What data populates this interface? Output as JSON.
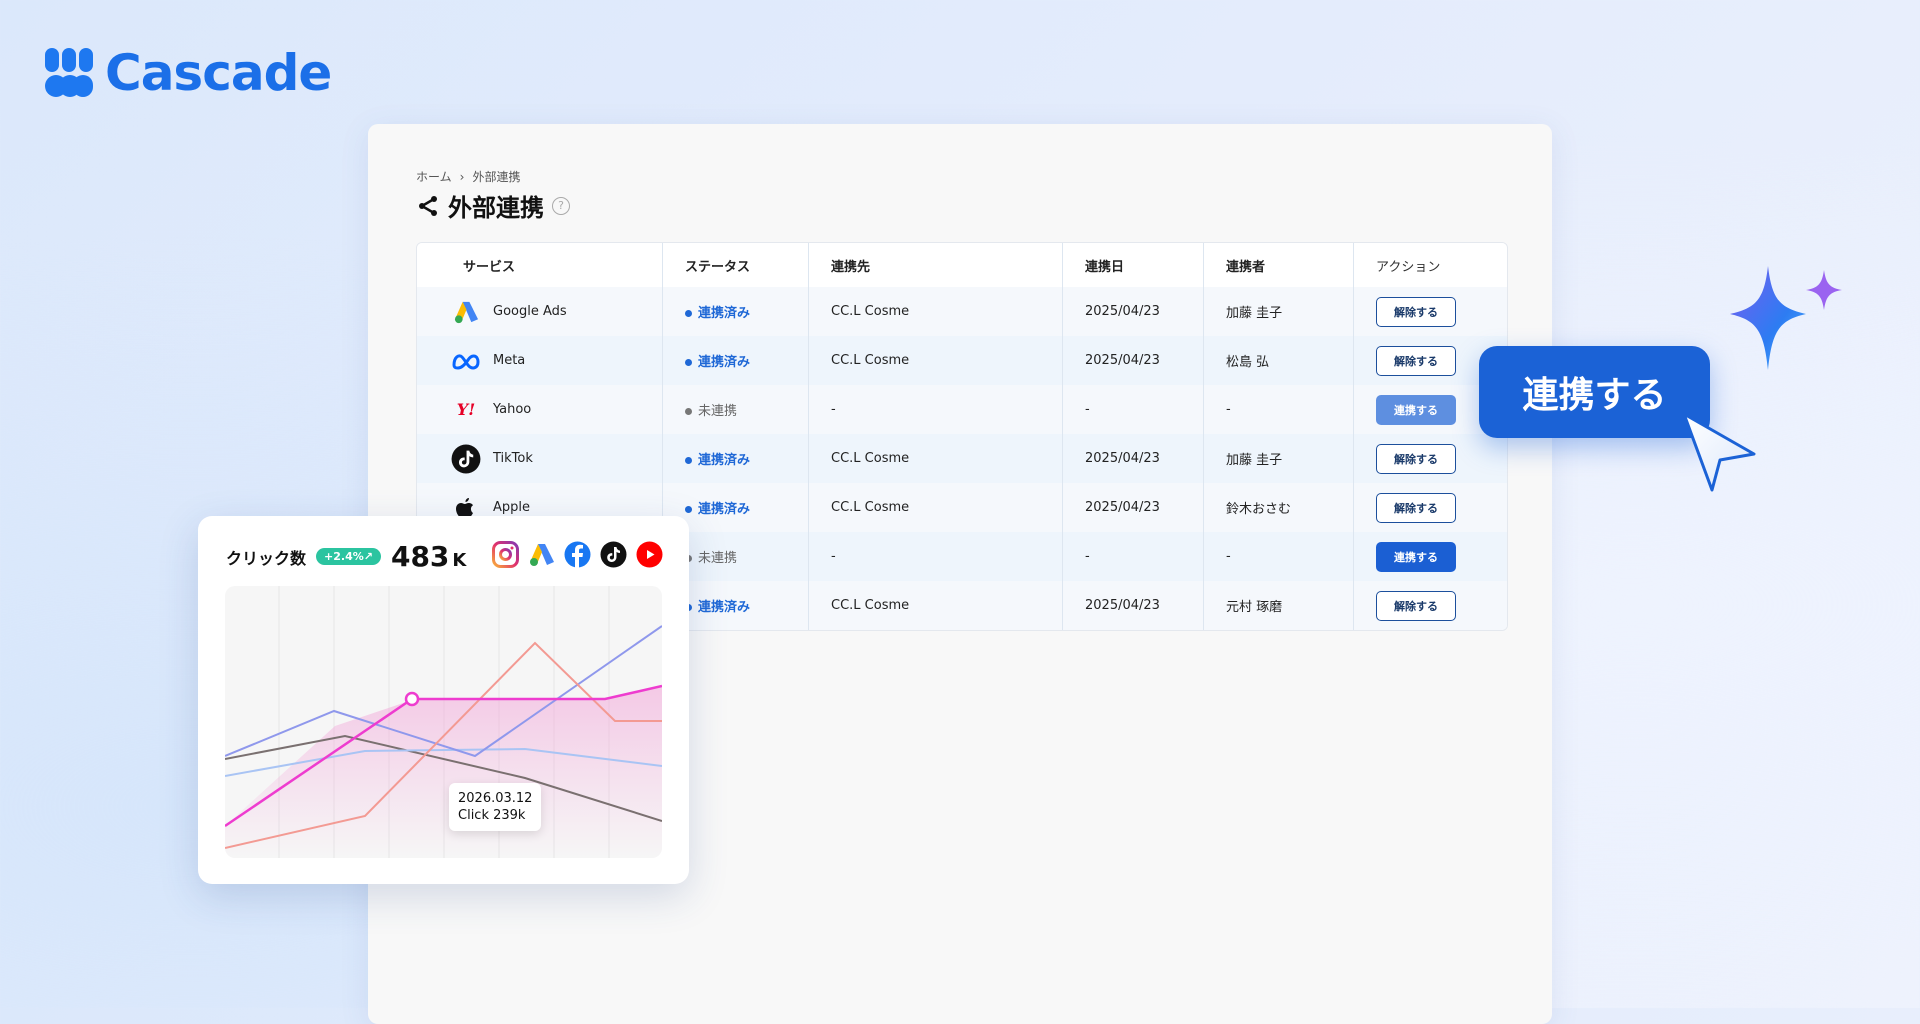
{
  "brand": {
    "name": "Cascade",
    "color": "#1b6fe8"
  },
  "breadcrumb": {
    "home": "ホーム",
    "current": "外部連携"
  },
  "page": {
    "title": "外部連携"
  },
  "table": {
    "headers": [
      "サービス",
      "ステータス",
      "連携先",
      "連携日",
      "連携者",
      "アクション"
    ],
    "rows": [
      {
        "service": "Google Ads",
        "icon": "google-ads-icon",
        "status": "連携済み",
        "linked": true,
        "dest": "CC.L Cosme",
        "date": "2025/04/23",
        "user": "加藤 圭子",
        "action": "解除する",
        "action_style": "outline"
      },
      {
        "service": "Meta",
        "icon": "meta-icon",
        "status": "連携済み",
        "linked": true,
        "dest": "CC.L Cosme",
        "date": "2025/04/23",
        "user": "松島 弘",
        "action": "解除する",
        "action_style": "outline"
      },
      {
        "service": "Yahoo",
        "icon": "yahoo-icon",
        "status": "未連携",
        "linked": false,
        "dest": "-",
        "date": "-",
        "user": "-",
        "action": "連携する",
        "action_style": "light"
      },
      {
        "service": "TikTok",
        "icon": "tiktok-icon",
        "status": "連携済み",
        "linked": true,
        "dest": "CC.L Cosme",
        "date": "2025/04/23",
        "user": "加藤 圭子",
        "action": "解除する",
        "action_style": "outline"
      },
      {
        "service": "Apple",
        "icon": "apple-icon",
        "status": "連携済み",
        "linked": true,
        "dest": "CC.L Cosme",
        "date": "2025/04/23",
        "user": "鈴木おさむ",
        "action": "解除する",
        "action_style": "outline"
      },
      {
        "service": "",
        "icon": "",
        "status": "未連携",
        "linked": false,
        "dest": "-",
        "date": "-",
        "user": "-",
        "action": "連携する",
        "action_style": "fill"
      },
      {
        "service": "",
        "icon": "",
        "status": "連携済み",
        "linked": true,
        "dest": "CC.L Cosme",
        "date": "2025/04/23",
        "user": "元村 琢磨",
        "action": "解除する",
        "action_style": "outline"
      }
    ]
  },
  "cta": {
    "label": "連携する"
  },
  "card": {
    "label": "クリック数",
    "badge": "+2.4%↗",
    "kpi_value": "483",
    "kpi_unit": "K",
    "tooltip_date": "2026.03.12",
    "tooltip_value": "Click 239k",
    "social_icons": [
      "instagram-icon",
      "google-ads-icon",
      "facebook-icon",
      "tiktok-icon",
      "youtube-icon"
    ]
  },
  "colors": {
    "accent": "#1b62d6",
    "linked": "#1f68d6",
    "unlinked": "#777777"
  }
}
